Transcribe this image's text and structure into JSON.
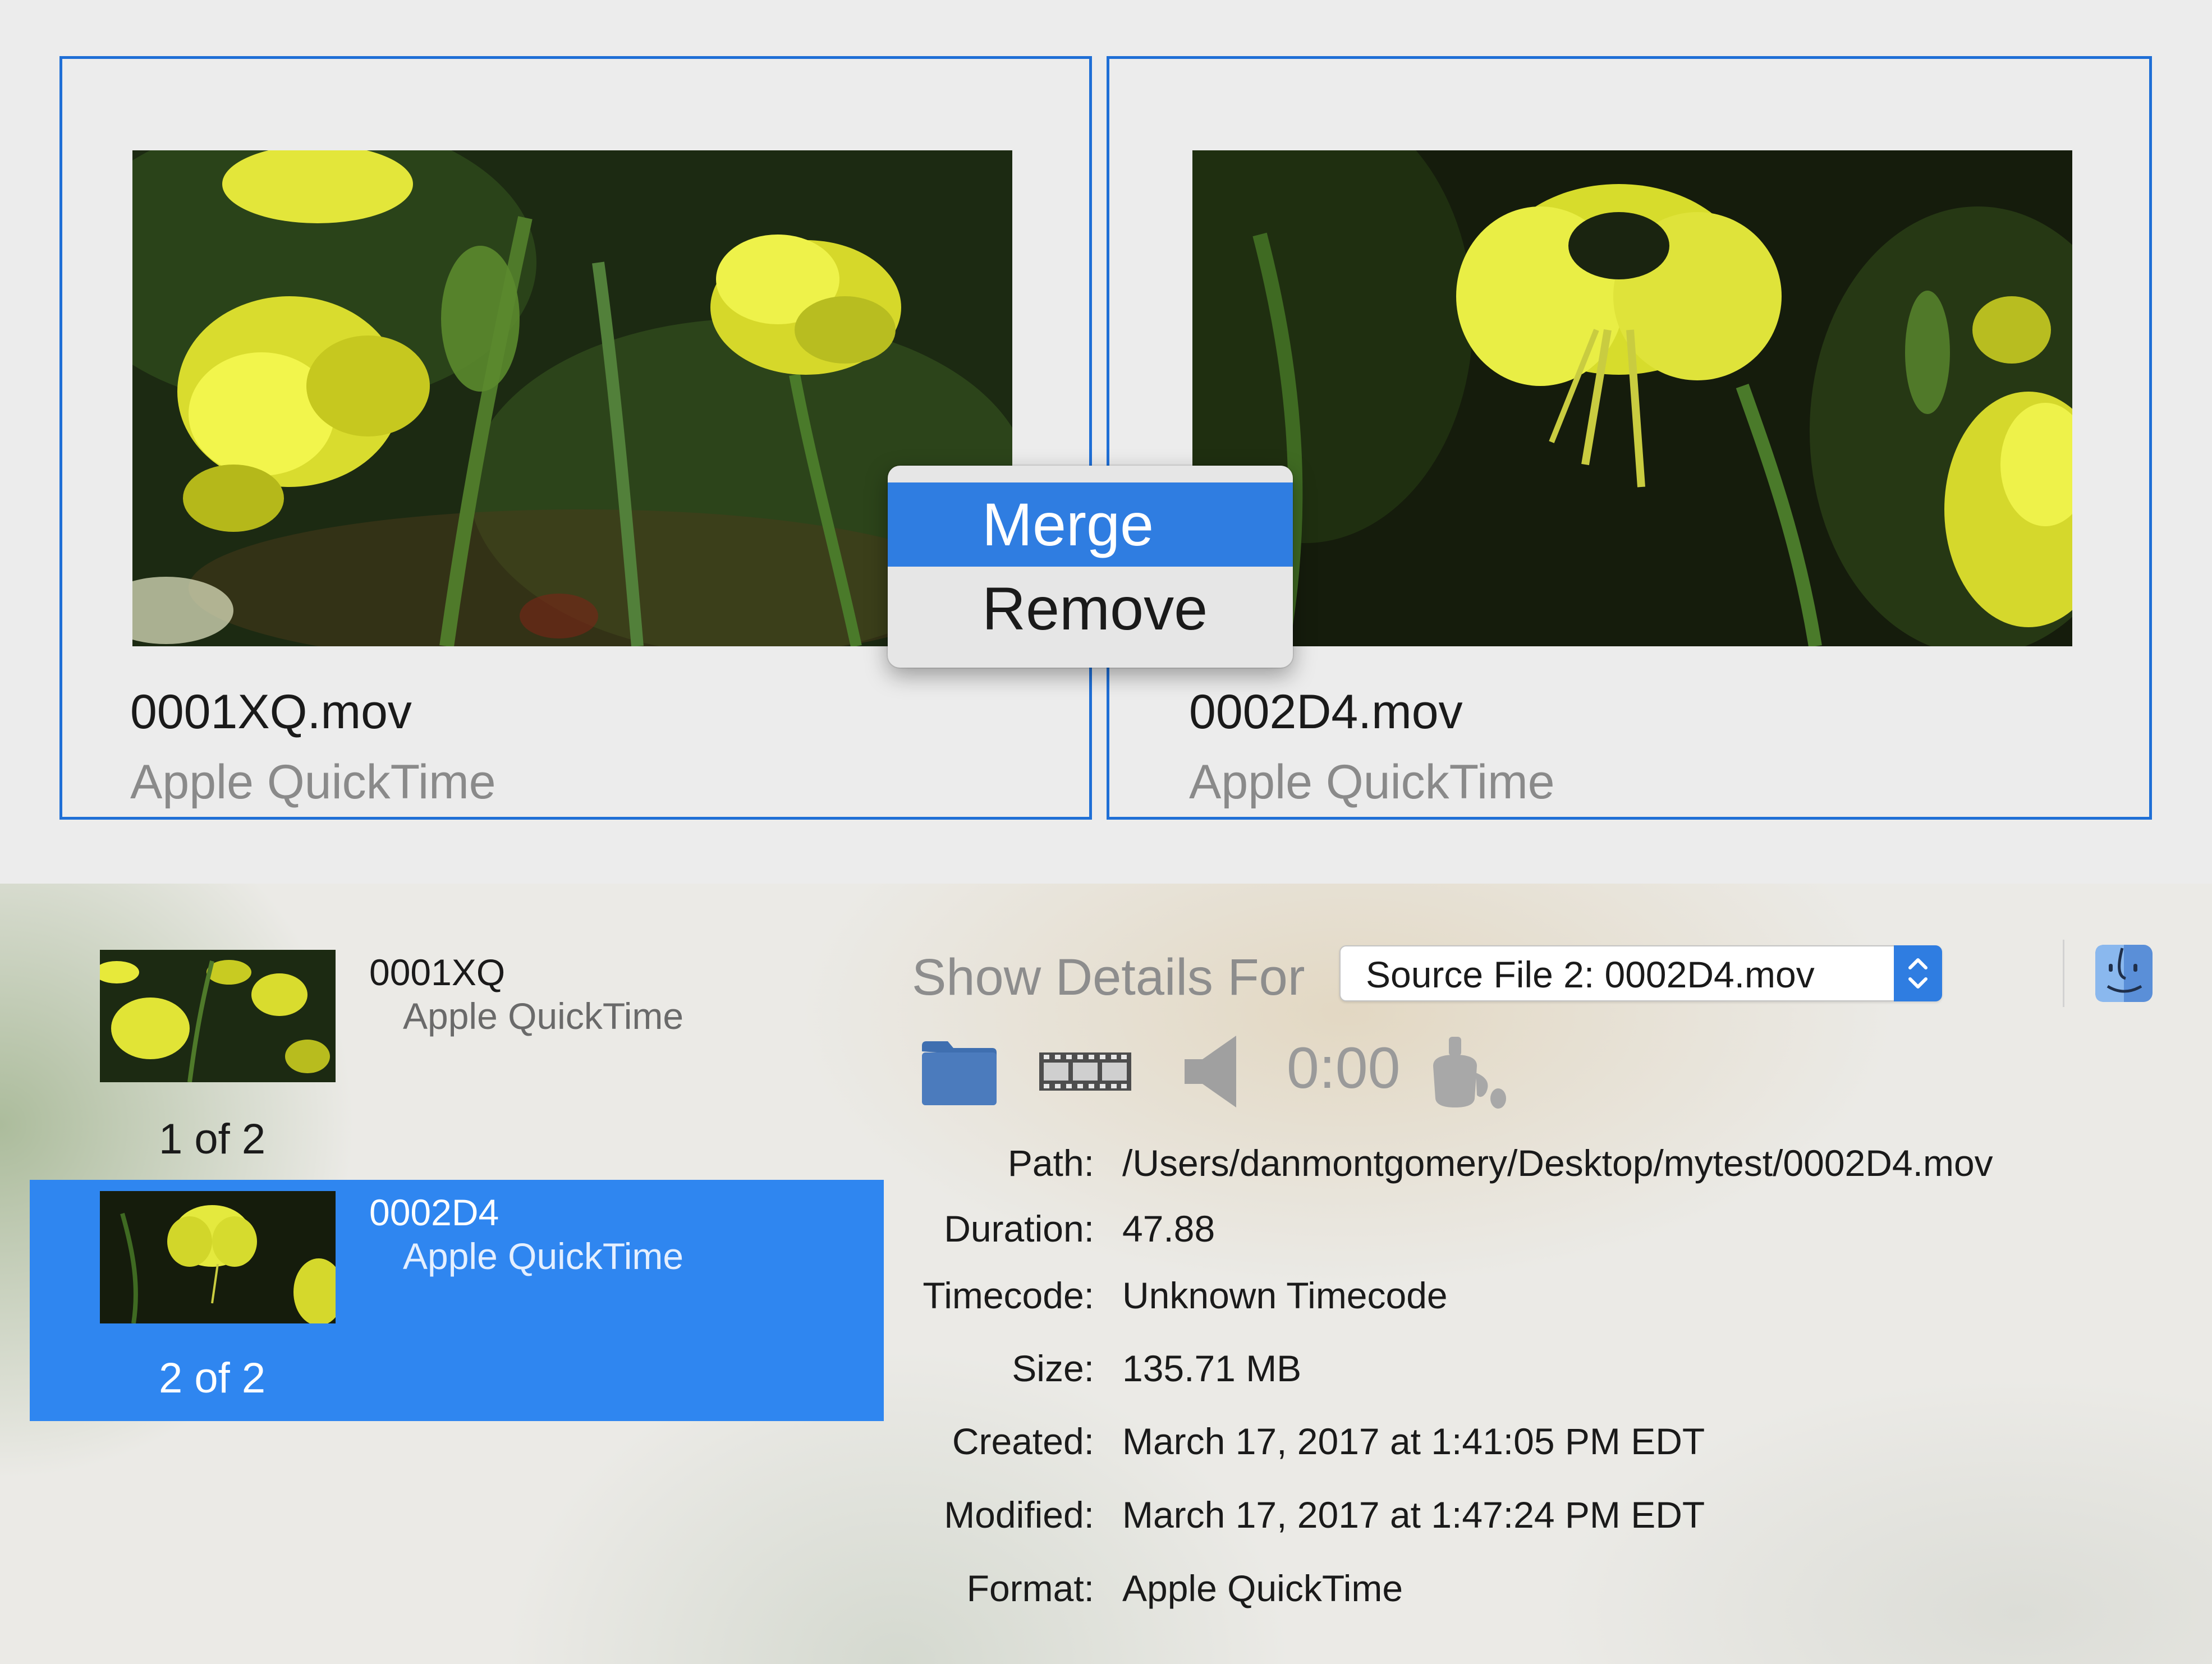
{
  "clips": [
    {
      "filename": "0001XQ.mov",
      "format": "Apple QuickTime"
    },
    {
      "filename": "0002D4.mov",
      "format": "Apple QuickTime"
    }
  ],
  "context_menu": {
    "items": [
      "Merge",
      "Remove"
    ],
    "highlighted": "Merge"
  },
  "source_list": [
    {
      "name": "0001XQ",
      "format": "Apple QuickTime",
      "count": "1 of 2",
      "selected": false
    },
    {
      "name": "0002D4",
      "format": "Apple QuickTime",
      "count": "2 of 2",
      "selected": true
    }
  ],
  "details": {
    "show_details_label": "Show Details For",
    "source_select_value": "Source File 2: 0002D4.mov",
    "time": "0:00",
    "rows": [
      {
        "label": "Path:",
        "value": "/Users/danmontgomery/Desktop/mytest/0002D4.mov"
      },
      {
        "label": "Duration:",
        "value": "47.88"
      },
      {
        "label": "Timecode:",
        "value": "Unknown Timecode"
      },
      {
        "label": "Size:",
        "value": "135.71 MB"
      },
      {
        "label": "Created:",
        "value": "March 17, 2017 at 1:41:05 PM EDT"
      },
      {
        "label": "Modified:",
        "value": "March 17, 2017 at 1:47:24 PM EDT"
      },
      {
        "label": "Format:",
        "value": "Apple QuickTime"
      }
    ]
  },
  "icons": {
    "toolbar": [
      "folder-icon",
      "filmstrip-icon",
      "speaker-icon",
      "paint-bucket-icon"
    ],
    "finder": "finder-icon",
    "select_arrows": "up-down-chevron-icon"
  },
  "colors": {
    "selection_blue": "#2f86f0",
    "menu_highlight": "#2f7de1",
    "card_border": "#1f6fd6",
    "muted_text": "#8a8a8a",
    "toolbar_icon_blue": "#4b7bbd"
  }
}
